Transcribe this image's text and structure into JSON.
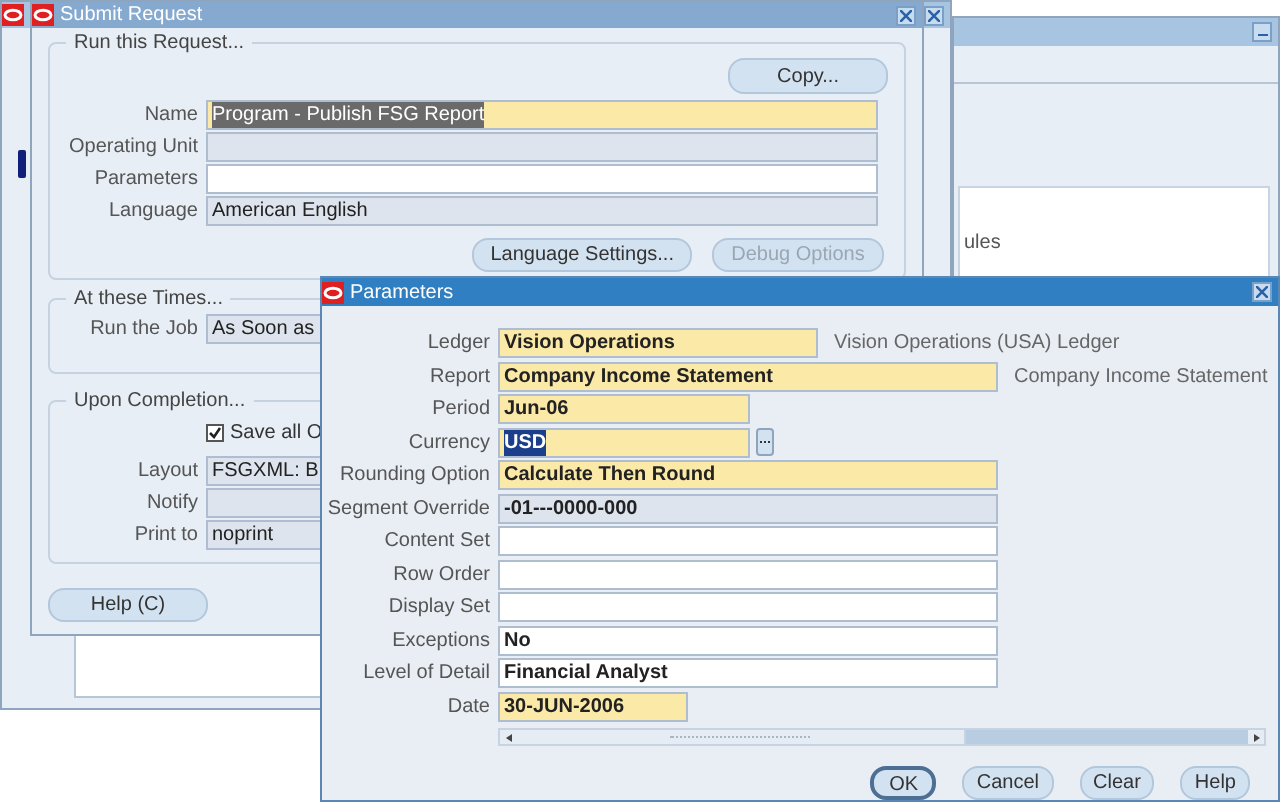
{
  "back_window": {
    "fragment_text": "ules"
  },
  "submit_request": {
    "title": "Submit Request",
    "run_group": {
      "title": "Run this Request...",
      "copy_button": "Copy...",
      "fields": [
        {
          "label": "Name",
          "value": "Program - Publish FSG Report",
          "kind": "required",
          "selected": true
        },
        {
          "label": "Operating Unit",
          "kind": "readonly"
        },
        {
          "label": "Parameters",
          "kind": "optional"
        },
        {
          "label": "Language",
          "value": "American English",
          "kind": "readonly"
        }
      ],
      "buttons": [
        {
          "label": "Language Settings...",
          "disabled": false
        },
        {
          "label": "Debug Options",
          "disabled": true
        }
      ]
    },
    "times_group": {
      "title": "At these Times...",
      "fields": [
        {
          "label": "Run the Job",
          "value": "As Soon as",
          "kind": "readonly"
        }
      ]
    },
    "completion_group": {
      "title": "Upon Completion...",
      "save_checkbox": {
        "label": "Save all O",
        "checked": true
      },
      "fields": [
        {
          "label": "Layout",
          "value": "FSGXML: B",
          "kind": "readonly"
        },
        {
          "label": "Notify",
          "kind": "readonly"
        },
        {
          "label": "Print to",
          "value": "noprint",
          "kind": "readonly"
        }
      ]
    },
    "help_button": "Help (C)"
  },
  "parameters": {
    "title": "Parameters",
    "fields": [
      {
        "label": "Ledger",
        "value": "Vision Operations",
        "kind": "required",
        "description": "Vision Operations (USA) Ledger"
      },
      {
        "label": "Report",
        "value": "Company Income Statement",
        "kind": "required",
        "description": "Company Income Statement"
      },
      {
        "label": "Period",
        "value": "Jun-06",
        "kind": "required"
      },
      {
        "label": "Currency",
        "value": "USD",
        "kind": "required",
        "selected": true,
        "lov": true
      },
      {
        "label": "Rounding Option",
        "value": "Calculate Then Round",
        "kind": "required"
      },
      {
        "label": "Segment Override",
        "value": "-01---0000-000",
        "kind": "readonly"
      },
      {
        "label": "Content Set",
        "kind": "optional"
      },
      {
        "label": "Row Order",
        "kind": "optional"
      },
      {
        "label": "Display Set",
        "kind": "optional"
      },
      {
        "label": "Exceptions",
        "value": "No",
        "kind": "optional"
      },
      {
        "label": "Level of Detail",
        "value": "Financial Analyst",
        "kind": "optional"
      },
      {
        "label": "Date",
        "value": "30-JUN-2006",
        "kind": "required"
      }
    ],
    "buttons": [
      {
        "label": "OK",
        "default": true
      },
      {
        "label": "Cancel",
        "default": false
      },
      {
        "label": "Clear",
        "default": false
      },
      {
        "label": "Help",
        "default": false
      }
    ]
  }
}
